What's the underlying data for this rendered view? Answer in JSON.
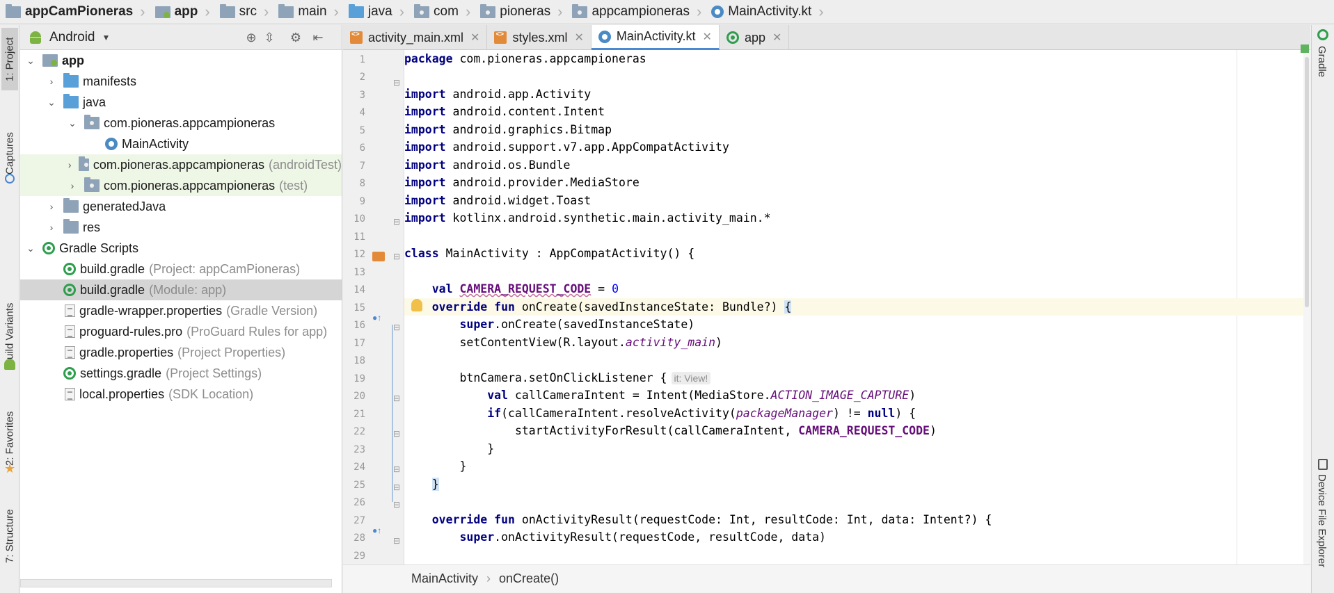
{
  "nav_bar": {
    "crumbs": [
      {
        "label": "appCamPioneras",
        "bold": true
      },
      {
        "label": "app",
        "bold": true
      },
      {
        "label": "src"
      },
      {
        "label": "main"
      },
      {
        "label": "java"
      },
      {
        "label": "com"
      },
      {
        "label": "pioneras"
      },
      {
        "label": "appcampioneras"
      },
      {
        "label": "MainActivity.kt"
      }
    ]
  },
  "left_stripe": {
    "project": "1: Project",
    "captures": "Captures",
    "build_variants": "Build Variants",
    "favorites": "2: Favorites",
    "structure": "7: Structure"
  },
  "right_stripe": {
    "gradle": "Gradle",
    "device_file_explorer": "Device File Explorer"
  },
  "project_panel": {
    "view_mode": "Android",
    "tree": [
      {
        "label": "app",
        "hint": ""
      },
      {
        "label": "manifests",
        "hint": ""
      },
      {
        "label": "java",
        "hint": ""
      },
      {
        "label": "com.pioneras.appcampioneras",
        "hint": ""
      },
      {
        "label": "MainActivity",
        "hint": ""
      },
      {
        "label": "com.pioneras.appcampioneras",
        "hint": "(androidTest)"
      },
      {
        "label": "com.pioneras.appcampioneras",
        "hint": "(test)"
      },
      {
        "label": "generatedJava",
        "hint": ""
      },
      {
        "label": "res",
        "hint": ""
      },
      {
        "label": "Gradle Scripts",
        "hint": ""
      },
      {
        "label": "build.gradle",
        "hint": "(Project: appCamPioneras)"
      },
      {
        "label": "build.gradle",
        "hint": "(Module: app)"
      },
      {
        "label": "gradle-wrapper.properties",
        "hint": "(Gradle Version)"
      },
      {
        "label": "proguard-rules.pro",
        "hint": "(ProGuard Rules for app)"
      },
      {
        "label": "gradle.properties",
        "hint": "(Project Properties)"
      },
      {
        "label": "settings.gradle",
        "hint": "(Project Settings)"
      },
      {
        "label": "local.properties",
        "hint": "(SDK Location)"
      }
    ]
  },
  "editor_tabs": [
    {
      "label": "activity_main.xml"
    },
    {
      "label": "styles.xml"
    },
    {
      "label": "MainActivity.kt",
      "active": true
    },
    {
      "label": "app"
    }
  ],
  "editor": {
    "lines": [
      {
        "n": "1"
      },
      {
        "n": "2"
      },
      {
        "n": "3"
      },
      {
        "n": "4"
      },
      {
        "n": "5"
      },
      {
        "n": "6"
      },
      {
        "n": "7"
      },
      {
        "n": "8"
      },
      {
        "n": "9"
      },
      {
        "n": "10"
      },
      {
        "n": "11"
      },
      {
        "n": "12"
      },
      {
        "n": "13"
      },
      {
        "n": "14"
      },
      {
        "n": "15"
      },
      {
        "n": "16"
      },
      {
        "n": "17"
      },
      {
        "n": "18"
      },
      {
        "n": "19"
      },
      {
        "n": "20"
      },
      {
        "n": "21"
      },
      {
        "n": "22"
      },
      {
        "n": "23"
      },
      {
        "n": "24"
      },
      {
        "n": "25"
      },
      {
        "n": "26"
      },
      {
        "n": "27"
      },
      {
        "n": "28"
      },
      {
        "n": "29"
      }
    ],
    "code": {
      "l1_kw": "package",
      "l1_rest": " com.pioneras.appcampioneras",
      "l3_kw": "import",
      "l3_rest": " android.app.Activity",
      "l4_kw": "import",
      "l4_rest": " android.content.Intent",
      "l5_kw": "import",
      "l5_rest": " android.graphics.Bitmap",
      "l6_kw": "import",
      "l6_rest": " android.support.v7.app.AppCompatActivity",
      "l7_kw": "import",
      "l7_rest": " android.os.Bundle",
      "l8_kw": "import",
      "l8_rest": " android.provider.MediaStore",
      "l9_kw": "import",
      "l9_rest": " android.widget.Toast",
      "l10_kw": "import",
      "l10_rest": " kotlinx.android.synthetic.main.activity_main.*",
      "l12_kw": "class",
      "l12_rest": " MainActivity : AppCompatActivity() {",
      "l14_indent": "    ",
      "l14_kw": "val",
      "l14_sp": " ",
      "l14_prop": "CAMERA_REQUEST_CODE",
      "l14_eq": " = ",
      "l14_num": "0",
      "l16_indent": "    ",
      "l16_kw": "override fun",
      "l16_rest": " onCreate(savedInstanceState: Bundle?) ",
      "l16_brace": "{",
      "l17_indent": "        ",
      "l17_kw": "super",
      "l17_rest": ".onCreate(savedInstanceState)",
      "l18_rest": "        setContentView(R.layout.",
      "l18_ital": "activity_main",
      "l18_end": ")",
      "l20_rest": "        btnCamera.setOnClickListener {",
      "l20_hint": "it: View!",
      "l21_indent": "            ",
      "l21_kw": "val",
      "l21_rest": " callCameraIntent = Intent(MediaStore.",
      "l21_ital": "ACTION_IMAGE_CAPTURE",
      "l21_end": ")",
      "l22_indent": "            ",
      "l22_kw": "if",
      "l22_rest": "(callCameraIntent.resolveActivity(",
      "l22_ital": "packageManager",
      "l22_mid": ") != ",
      "l22_kw2": "null",
      "l22_end": ") {",
      "l23_rest": "                startActivityForResult(callCameraIntent, ",
      "l23_prop": "CAMERA_REQUEST_CODE",
      "l23_end": ")",
      "l24_rest": "            }",
      "l25_rest": "        }",
      "l26_indent": "    ",
      "l26_brace": "}",
      "l28_indent": "    ",
      "l28_kw": "override fun",
      "l28_rest": " onActivityResult(requestCode: Int, resultCode: Int, data: Intent?) {",
      "l29_indent": "        ",
      "l29_kw": "super",
      "l29_rest": ".onActivityResult(requestCode, resultCode, data)"
    }
  },
  "bottom_breadcrumb": {
    "class": "MainActivity",
    "method": "onCreate()"
  },
  "colors": {
    "keyword": "#000080",
    "number": "#0000ff",
    "property": "#660e7a",
    "current_line": "#fcfae6",
    "gradle_green": "#2e9e4e"
  }
}
